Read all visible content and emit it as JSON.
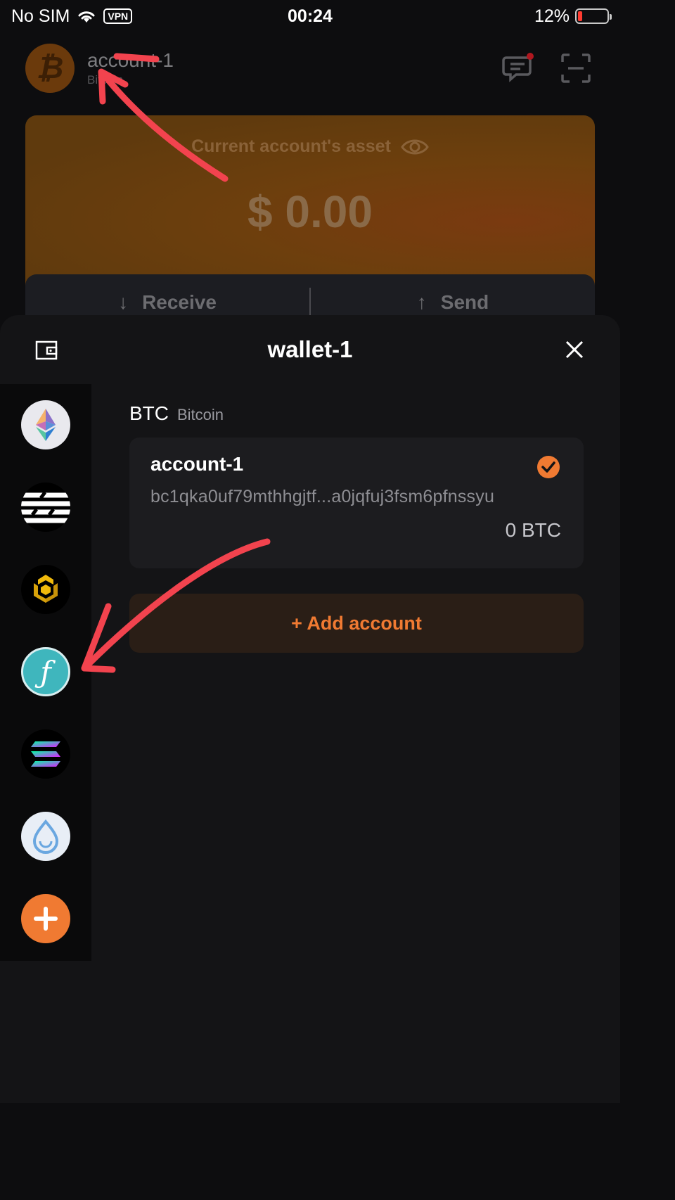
{
  "status_bar": {
    "carrier": "No SIM",
    "vpn": "VPN",
    "time": "00:24",
    "battery": "12%"
  },
  "background": {
    "account_name": "account-1",
    "account_chain": "Bitcoin",
    "asset_label": "Current account's asset",
    "asset_amount": "$ 0.00",
    "receive_label": "Receive",
    "send_label": "Send"
  },
  "sheet": {
    "title": "wallet-1",
    "chains": [
      {
        "name": "ethereum-icon"
      },
      {
        "name": "aptos-icon"
      },
      {
        "name": "bnb-icon"
      },
      {
        "name": "filecoin-icon"
      },
      {
        "name": "solana-icon"
      },
      {
        "name": "sui-icon"
      },
      {
        "name": "add-chain-icon"
      }
    ],
    "chain_symbol": "BTC",
    "chain_name": "Bitcoin",
    "account": {
      "name": "account-1",
      "address": "bc1qka0uf79mthhgjtf...a0jqfuj3fsm6pfnssyu",
      "balance": "0 BTC"
    },
    "add_account_label": "+ Add account"
  },
  "colors": {
    "accent": "#f07a32",
    "annotation": "#f2434e"
  }
}
